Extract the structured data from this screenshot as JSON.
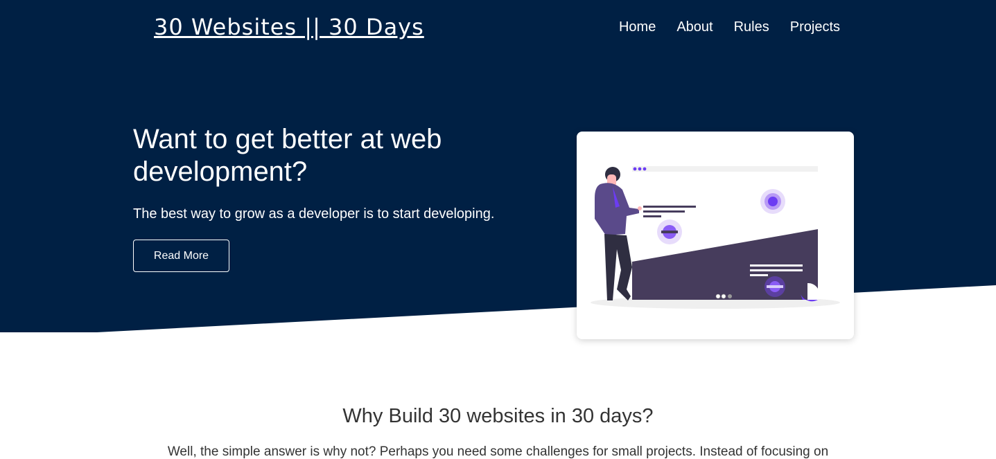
{
  "colors": {
    "hero_bg": "#002044",
    "accent": "#6c3cf3",
    "figure": "#463c5c"
  },
  "header": {
    "logo": "30 Websites || 30 Days",
    "nav": [
      "Home",
      "About",
      "Rules",
      "Projects"
    ]
  },
  "hero": {
    "headline": "Want to get better at web development?",
    "subtext": "The best way to grow as a developer is to start developing.",
    "button_label": "Read More",
    "illustration_icon": "presentation-illustration-icon"
  },
  "why": {
    "title": "Why Build 30 websites in 30 days?",
    "text": "Well, the simple answer is why not? Perhaps you need some challenges for small projects. Instead of focusing on"
  }
}
